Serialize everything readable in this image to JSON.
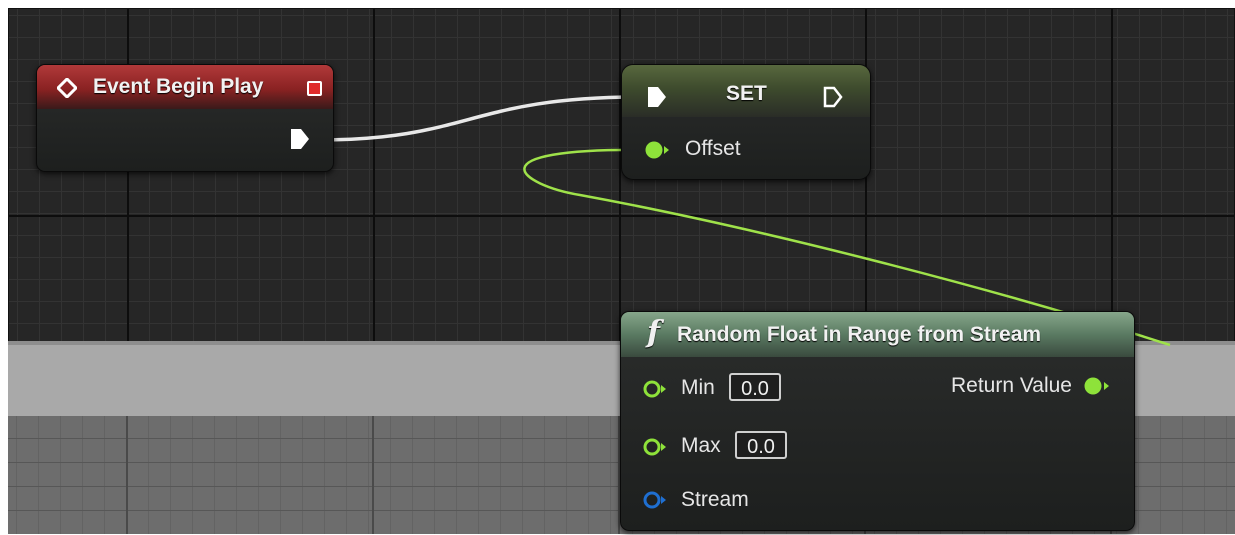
{
  "graph": {
    "colors": {
      "canvas_dark": "#262626",
      "exec_wire": "#e8e8e8",
      "float_wire": "#9fe24a",
      "event_header": "#a52f30",
      "set_header": "#4d5b38",
      "function_header": "#78987e",
      "float_pin": "#8ee23a",
      "stream_pin": "#1f6fd1"
    }
  },
  "event_node": {
    "title": "Event Begin Play",
    "icon": "event-diamond-icon",
    "delegate_icon": "delegate-square-icon",
    "exec_out_icon": "exec-pin-icon"
  },
  "set_node": {
    "title": "SET",
    "pins": {
      "exec_in_icon": "exec-pin-icon",
      "exec_out_icon": "exec-pin-outline-icon",
      "variable_label": "Offset",
      "variable_icon": "float-pin-icon"
    }
  },
  "random_node": {
    "title": "Random Float in Range from Stream",
    "function_icon": "f",
    "inputs": [
      {
        "label": "Min",
        "value": "0.0",
        "icon": "float-pin-outline-icon"
      },
      {
        "label": "Max",
        "value": "0.0",
        "icon": "float-pin-outline-icon"
      },
      {
        "label": "Stream",
        "icon": "struct-pin-outline-icon"
      }
    ],
    "output": {
      "label": "Return Value",
      "icon": "float-pin-icon"
    }
  }
}
